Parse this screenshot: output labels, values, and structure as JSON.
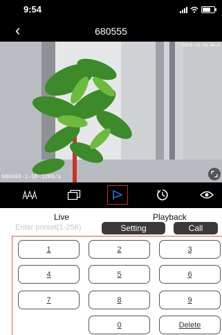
{
  "status_bar": {
    "time": "9:54"
  },
  "nav": {
    "title": "680555"
  },
  "video": {
    "osd_date": "2018-11-16 09:5",
    "osd_stream": "680555-1-SD-12Kb/s"
  },
  "controls": [
    {
      "name": "fisheye-icon",
      "active": false
    },
    {
      "name": "multiview-icon",
      "active": false
    },
    {
      "name": "ptz-icon",
      "active": true
    },
    {
      "name": "timer-icon",
      "active": false
    },
    {
      "name": "eye-icon",
      "active": false
    }
  ],
  "tabs": {
    "live": "Live",
    "playback": "Playback"
  },
  "preset": {
    "placeholder": "Enter preset(1-256)",
    "setting_label": "Setting",
    "call_label": "Call"
  },
  "keypad": {
    "keys": [
      "1",
      "2",
      "3",
      "4",
      "5",
      "6",
      "7",
      "8",
      "9",
      "0"
    ],
    "delete_label": "Delete"
  },
  "colors": {
    "accent_border": "#d85a5a",
    "active_icon": "#3a6fd8"
  }
}
